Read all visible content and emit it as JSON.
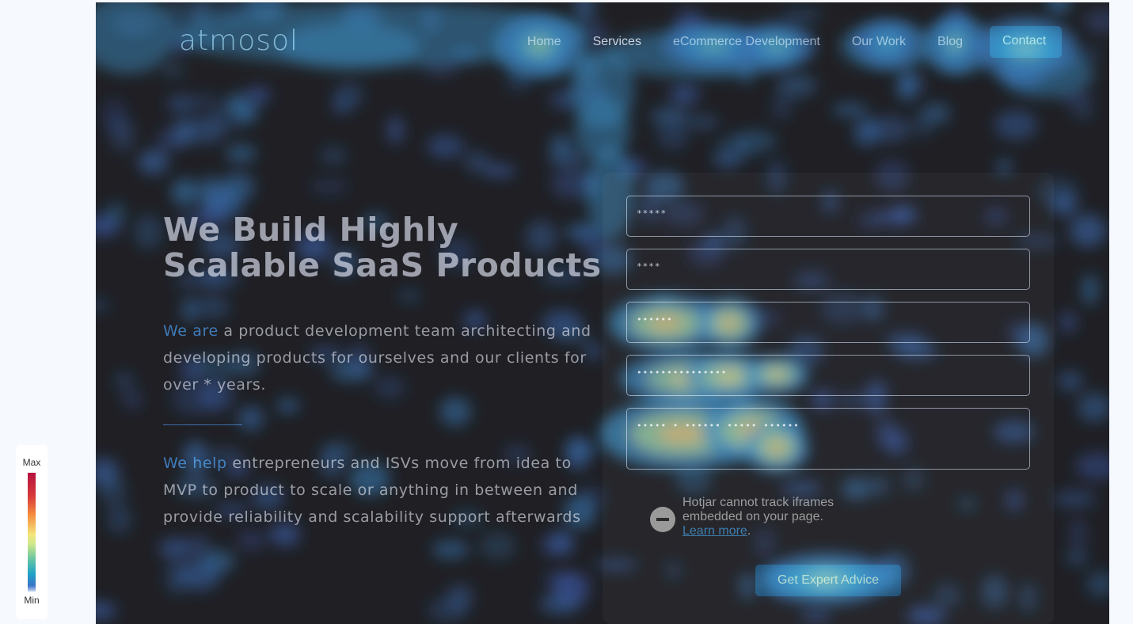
{
  "site": {
    "logo": "atmosol",
    "nav": [
      {
        "label": "Home"
      },
      {
        "label": "Services"
      },
      {
        "label": "eCommerce Development"
      },
      {
        "label": "Our Work"
      },
      {
        "label": "Blog"
      }
    ],
    "contact_label": "Contact"
  },
  "hero": {
    "title": "We Build Highly Scalable SaaS Products",
    "p1_accent": "We are",
    "p1_rest": " a product development team architecting and developing products for ourselves and our clients for over * years.",
    "p2_accent": "We help",
    "p2_rest": " entrepreneurs and ISVs move from idea to MVP to product to scale or anything in between and provide reliability and scalability support afterwards"
  },
  "form": {
    "fields": [
      {
        "value": "*****"
      },
      {
        "value": "****"
      },
      {
        "value": "••••••"
      },
      {
        "value": "•••••••••••••••"
      },
      {
        "value": "••••• • •••••• ••••• ••••••"
      }
    ],
    "iframe_notice": {
      "text": "Hotjar cannot track iframes embedded on your page.",
      "link": "Learn more",
      "suffix": "."
    },
    "submit_label": "Get Expert Advice"
  },
  "legend": {
    "max_label": "Max",
    "min_label": "Min",
    "colors": [
      "#b5123f",
      "#f58a3c",
      "#f4e57a",
      "#6cc7a0",
      "#1ea3c6",
      "#3a74c8"
    ]
  },
  "heatmap": {
    "type": "click-heatmap",
    "hotspots": [
      {
        "target": "nav-home",
        "intensity": 0.55
      },
      {
        "target": "nav-ecommerce",
        "intensity": 0.45
      },
      {
        "target": "nav-our-work",
        "intensity": 0.4
      },
      {
        "target": "nav-blog",
        "intensity": 0.5
      },
      {
        "target": "nav-contact",
        "intensity": 0.5
      },
      {
        "target": "field-3",
        "intensity": 0.85
      },
      {
        "target": "field-4",
        "intensity": 0.8
      },
      {
        "target": "field-5",
        "intensity": 0.85
      },
      {
        "target": "submit-button",
        "intensity": 0.55
      }
    ]
  }
}
